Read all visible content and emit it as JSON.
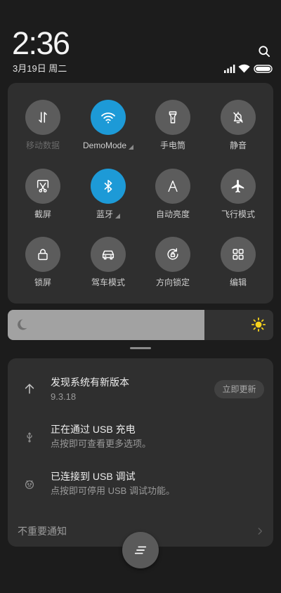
{
  "header": {
    "time": "2:36",
    "date": "3月19日 周二",
    "search_icon": "search-icon",
    "status_icons": [
      "signal-icon",
      "wifi-icon",
      "battery-icon"
    ]
  },
  "quick_settings": {
    "accent_color": "#1d9ad7",
    "tiles": [
      {
        "label": "移动数据",
        "icon": "mobile-data-icon",
        "active": false,
        "dimmed": true
      },
      {
        "label": "DemoMode",
        "icon": "wifi-icon",
        "active": true,
        "has_menu": true
      },
      {
        "label": "手电筒",
        "icon": "flashlight-icon",
        "active": false
      },
      {
        "label": "静音",
        "icon": "mute-icon",
        "active": false
      },
      {
        "label": "截屏",
        "icon": "screenshot-icon",
        "active": false
      },
      {
        "label": "蓝牙",
        "icon": "bluetooth-icon",
        "active": true,
        "has_menu": true
      },
      {
        "label": "自动亮度",
        "icon": "auto-brightness-icon",
        "active": false
      },
      {
        "label": "飞行模式",
        "icon": "airplane-icon",
        "active": false
      },
      {
        "label": "锁屏",
        "icon": "lock-icon",
        "active": false
      },
      {
        "label": "驾车模式",
        "icon": "car-icon",
        "active": false
      },
      {
        "label": "方向锁定",
        "icon": "rotation-lock-icon",
        "active": false
      },
      {
        "label": "编辑",
        "icon": "edit-icon",
        "active": false
      }
    ]
  },
  "brightness": {
    "level": 0.74,
    "min_icon": "moon-icon",
    "max_icon": "sun-icon",
    "sun_color": "#f6d21c"
  },
  "notifications": [
    {
      "icon": "system-update-icon",
      "title": "发现系统有新版本",
      "text": "9.3.18",
      "action": "立即更新"
    },
    {
      "icon": "usb-icon",
      "title": "正在通过 USB 充电",
      "text": "点按即可查看更多选项。"
    },
    {
      "icon": "usb-debug-icon",
      "title": "已连接到 USB 调试",
      "text": "点按即可停用 USB 调试功能。"
    }
  ],
  "unimportant": {
    "label": "不重要通知",
    "icon": "chevron-right-icon"
  },
  "clear_all": {
    "icon": "clear-all-icon"
  }
}
